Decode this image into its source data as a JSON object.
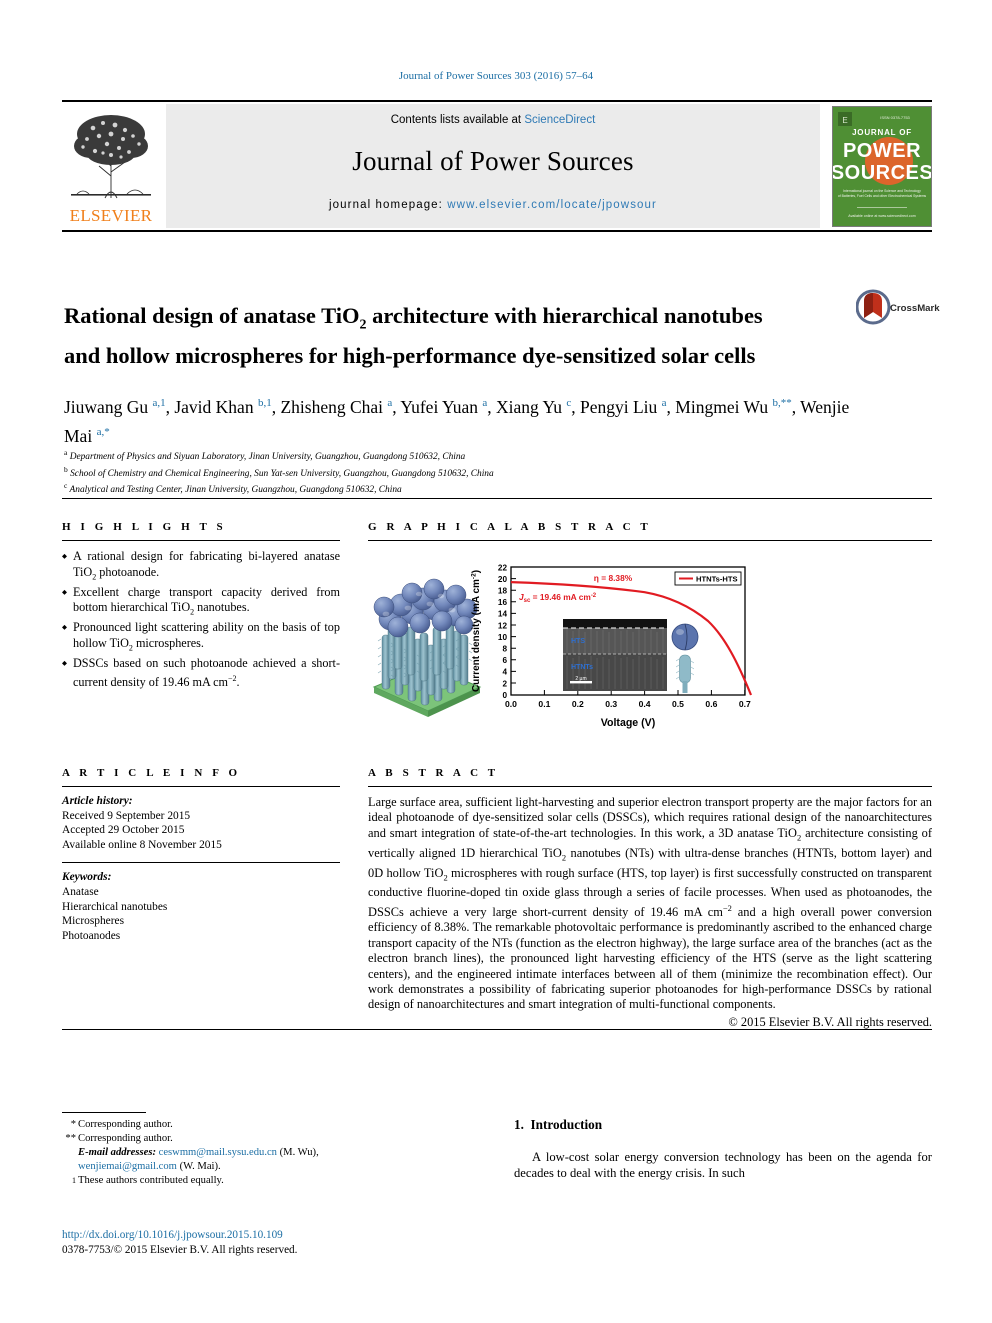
{
  "running_head": "Journal of Power Sources 303 (2016) 57–64",
  "masthead": {
    "contents_prefix": "Contents lists available at ",
    "sciencedirect": "ScienceDirect",
    "journal_name": "Journal of Power Sources",
    "homepage_label": "journal homepage: ",
    "homepage_url": "www.elsevier.com/locate/jpowsour",
    "publisher": "ELSEVIER",
    "cover_lines": [
      "JOURNAL OF",
      "POWER",
      "SOURCES"
    ],
    "cover_caption": "International journal on the Science and Technology of Electrochemical Energy Systems including Batteries, Fuel Cells and Supercapacitors",
    "cover_footer": "Available online at www.sciencedirect.com"
  },
  "crossmark_label": "CrossMark",
  "article": {
    "title_part1": "Rational design of anatase TiO",
    "title_sub": "2",
    "title_part2": " architecture with hierarchical nanotubes and hollow microspheres for high-performance dye-sensitized solar cells",
    "authors_line1": "Jiuwang Gu",
    "authors_html": "Jiuwang Gu a,1, Javid Khan b,1, Zhisheng Chai a, Yufei Yuan a, Xiang Yu c, Pengyi Liu a, Mingmei Wu b,**, Wenjie Mai a,*",
    "affiliations": [
      {
        "mark": "a",
        "text": "Department of Physics and Siyuan Laboratory, Jinan University, Guangzhou, Guangdong 510632, China"
      },
      {
        "mark": "b",
        "text": "School of Chemistry and Chemical Engineering, Sun Yat-sen University, Guangzhou, Guangdong 510632, China"
      },
      {
        "mark": "c",
        "text": "Analytical and Testing Center, Jinan University, Guangzhou, Guangdong 510632, China"
      }
    ]
  },
  "highlights": {
    "heading": "H I G H L I G H T S",
    "items": [
      "A rational design for fabricating bi-layered anatase TiO₂ photoanode.",
      "Excellent charge transport capacity derived from bottom hierarchical TiO₂ nanotubes.",
      "Pronounced light scattering ability on the basis of top hollow TiO₂ microspheres.",
      "DSSCs based on such photoanode achieved a short-current density of 19.46 mA cm⁻²."
    ]
  },
  "graphical_abstract": {
    "heading": "G R A P H I C A L   A B S T R A C T"
  },
  "article_info": {
    "heading": "A R T I C L E   I N F O",
    "history_label": "Article history:",
    "history": [
      "Received 9 September 2015",
      "Accepted 29 October 2015",
      "Available online 8 November 2015"
    ],
    "keywords_label": "Keywords:",
    "keywords": [
      "Anatase",
      "Hierarchical nanotubes",
      "Microspheres",
      "Photoanodes"
    ]
  },
  "abstract": {
    "heading": "A B S T R A C T",
    "text": "Large surface area, sufficient light-harvesting and superior electron transport property are the major factors for an ideal photoanode of dye-sensitized solar cells (DSSCs), which requires rational design of the nanoarchitectures and smart integration of state-of-the-art technologies. In this work, a 3D anatase TiO₂ architecture consisting of vertically aligned 1D hierarchical TiO₂ nanotubes (NTs) with ultra-dense branches (HTNTs, bottom layer) and 0D hollow TiO₂ microspheres with rough surface (HTS, top layer) is first successfully constructed on transparent conductive fluorine-doped tin oxide glass through a series of facile processes. When used as photoanodes, the DSSCs achieve a very large short-current density of 19.46 mA cm⁻² and a high overall power conversion efficiency of 8.38%. The remarkable photovoltaic performance is predominantly ascribed to the enhanced charge transport capacity of the NTs (function as the electron highway), the large surface area of the branches (act as the electron branch lines), the pronounced light harvesting efficiency of the HTS (serve as the light scattering centers), and the engineered intimate interfaces between all of them (minimize the recombination effect). Our work demonstrates a possibility of fabricating superior photoanodes for high-performance DSSCs by rational design of nanoarchitectures and smart integration of multi-functional components.",
    "copyright": "© 2015 Elsevier B.V. All rights reserved."
  },
  "footnotes": {
    "corr1_mark": "*",
    "corr1": "Corresponding author.",
    "corr2_mark": "**",
    "corr2": "Corresponding author.",
    "email_label": "E-mail addresses:",
    "email1": "ceswmm@mail.sysu.edu.cn",
    "email1_owner": "(M. Wu),",
    "email2": "wenjiemai@gmail.com",
    "email2_owner": "(W. Mai).",
    "equal_mark": "1",
    "equal": "These authors contributed equally."
  },
  "doi": {
    "url": "http://dx.doi.org/10.1016/j.jpowsour.2015.10.109",
    "issn_line": "0378-7753/© 2015 Elsevier B.V. All rights reserved."
  },
  "introduction": {
    "number": "1.",
    "heading": "Introduction",
    "paragraph": "A low-cost solar energy conversion technology has been on the agenda for decades to deal with the energy crisis. In such"
  },
  "chart_data": {
    "type": "line",
    "title": "",
    "xlabel": "Voltage (V)",
    "ylabel": "Current density (mA cm⁻²)",
    "xlim": [
      0.0,
      0.75
    ],
    "ylim": [
      0,
      22
    ],
    "xticks": [
      "0.0",
      "0.1",
      "0.2",
      "0.3",
      "0.4",
      "0.5",
      "0.6",
      "0.7"
    ],
    "yticks": [
      "0",
      "2",
      "4",
      "6",
      "8",
      "10",
      "12",
      "14",
      "16",
      "18",
      "20",
      "22"
    ],
    "grid": false,
    "legend_position": "top-right",
    "series": [
      {
        "name": "HTNTs-HTS",
        "color": "#e11b22",
        "x": [
          0.0,
          0.05,
          0.1,
          0.15,
          0.2,
          0.25,
          0.3,
          0.35,
          0.4,
          0.45,
          0.5,
          0.55,
          0.6,
          0.65,
          0.7,
          0.715
        ],
        "y": [
          19.46,
          19.35,
          19.25,
          19.12,
          19.0,
          18.85,
          18.65,
          18.4,
          18.05,
          17.55,
          16.7,
          15.2,
          12.6,
          8.8,
          3.2,
          0.0
        ]
      }
    ],
    "annotations": [
      {
        "text": "η = 8.38%",
        "color": "#e11b22",
        "x": 0.3,
        "y": 20.3
      },
      {
        "text": "Jsc = 19.46 mA cm⁻²",
        "color": "#e11b22",
        "x": 0.06,
        "y": 17.2
      }
    ],
    "inset": {
      "label_top": "HTS",
      "label_bottom": "HTNTs",
      "scalebar": "2 μm"
    }
  }
}
